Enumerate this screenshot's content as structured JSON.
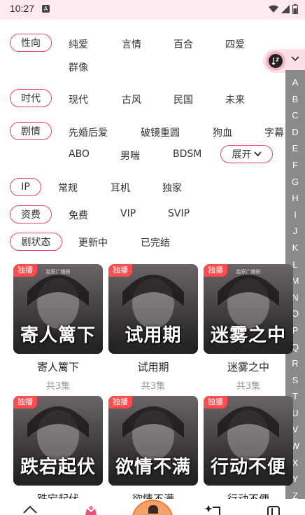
{
  "status": {
    "time": "10:27",
    "notif_glyph": "A"
  },
  "filters": {
    "orientation": {
      "label": "性向",
      "options": [
        "纯爱",
        "言情",
        "百合",
        "四爱",
        "群像"
      ]
    },
    "era": {
      "label": "时代",
      "options": [
        "现代",
        "古风",
        "民国",
        "未来"
      ]
    },
    "plot": {
      "label": "剧情",
      "options": [
        "先婚后爱",
        "破镜重圆",
        "狗血",
        "字幕",
        "ABO",
        "男喘",
        "BDSM"
      ],
      "expand": "展开"
    },
    "ip": {
      "label": "IP",
      "options": [
        "常规",
        "耳机",
        "独家"
      ]
    },
    "fee": {
      "label": "资费",
      "options": [
        "免费",
        "VIP",
        "SVIP"
      ]
    },
    "drama_status": {
      "label": "剧状态",
      "options": [
        "更新中",
        "已完结"
      ]
    }
  },
  "alphabet": [
    "A",
    "B",
    "C",
    "D",
    "E",
    "F",
    "G",
    "H",
    "I",
    "J",
    "K",
    "L",
    "M",
    "N",
    "O",
    "P",
    "Q",
    "R",
    "S",
    "T",
    "U",
    "V",
    "W",
    "X",
    "Y",
    "Z"
  ],
  "cards": [
    {
      "badge": "独播",
      "cover_text": "寄人篱下",
      "cover_small": "独家广播剧",
      "title": "寄人篱下",
      "count": "共3集",
      "bg": "#3a3236"
    },
    {
      "badge": "独播",
      "cover_text": "试用期",
      "cover_small": "",
      "title": "试用期",
      "count": "共3集",
      "bg": "#5d6a78"
    },
    {
      "badge": "独播",
      "cover_text": "迷雾之中",
      "cover_small": "独家广播剧",
      "title": "迷雾之中",
      "count": "共3集",
      "bg": "#2e2e30"
    },
    {
      "badge": "独播",
      "cover_text": "跌宕起伏",
      "cover_small": "",
      "title": "跌宕起伏",
      "count": "",
      "bg": "#4a4448"
    },
    {
      "badge": "独播",
      "cover_text": "欲情不满",
      "cover_small": "",
      "title": "欲情不满",
      "count": "",
      "bg": "#2a2628"
    },
    {
      "badge": "独播",
      "cover_text": "行动不便",
      "cover_small": "",
      "title": "行动不便",
      "count": "",
      "bg": "#3c3a3c"
    }
  ],
  "colors": {
    "accent": "#e0466e",
    "badge": "#ff4d4f",
    "index_bg": "#8a8a8a"
  },
  "icons": {
    "sort": "sort-az-icon",
    "chevron": "chevron-down-icon",
    "nav": [
      "home-icon",
      "flower-icon",
      "avatar",
      "sparkle-icon",
      "library-icon"
    ]
  }
}
